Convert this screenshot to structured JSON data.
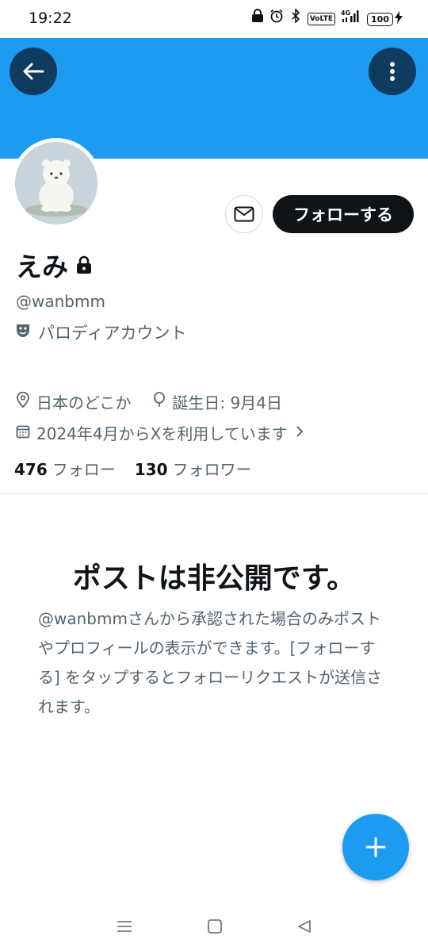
{
  "status_bar": {
    "time": "19:22",
    "battery": "100",
    "icons": [
      "nfc-lock-icon",
      "alarm-icon",
      "bluetooth-icon",
      "volte-icon",
      "4g-signal-icon",
      "battery-icon",
      "charging-icon"
    ]
  },
  "colors": {
    "banner": "#1d9bf0",
    "primary_text": "#0f1419",
    "secondary_text": "#536471",
    "accent": "#1d9bf0"
  },
  "profile": {
    "display_name": "えみ",
    "handle": "@wanbmm",
    "label": "パロディアカウント",
    "location": "日本のどこか",
    "birthday": "誕生日: 9月4日",
    "joined": "2024年4月からXを利用しています",
    "following_count": "476",
    "following_label": "フォロー",
    "followers_count": "130",
    "followers_label": "フォロワー"
  },
  "actions": {
    "follow_label": "フォローする"
  },
  "protected": {
    "title": "ポストは非公開です。",
    "body": "@wanbmmさんから承認された場合のみポストやプロフィールの表示ができます。[フォローする] をタップするとフォローリクエストが送信されます。"
  }
}
